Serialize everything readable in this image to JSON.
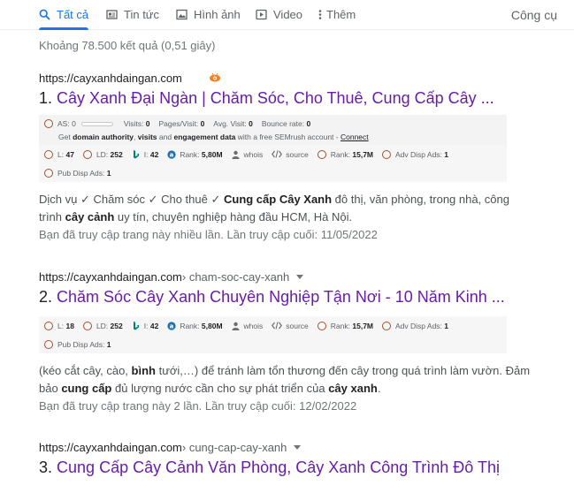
{
  "tabs": [
    {
      "label": "Tất cả"
    },
    {
      "label": "Tin tức"
    },
    {
      "label": "Hình ảnh"
    },
    {
      "label": "Video"
    },
    {
      "label": "Thêm"
    }
  ],
  "tools_label": "Công cụ",
  "stats": "Khoảng 78.500 kết quả (0,51 giây)",
  "colors": {
    "accent": "#1a73e8",
    "visited_link": "#681da8",
    "plugin_ring": "#a0522d"
  },
  "results": [
    {
      "url": "https://cayxanhdaingan.com",
      "path": "",
      "number": "1.",
      "title": "Cây Xanh Đại Ngàn | Chăm Sóc, Cho Thuê, Cung Cấp Cây ...",
      "seo": {
        "as_label": "AS:",
        "as_value": "0",
        "visits_label": "Visits:",
        "visits_value": "0",
        "pages_label": "Pages/Visit:",
        "pages_value": "0",
        "avg_label": "Avg. Visit:",
        "avg_value": "0",
        "bounce_label": "Bounce rate:",
        "bounce_value": "0",
        "promo_prefix": "Get",
        "promo_bold1": "domain authority",
        "promo_sep1": ",",
        "promo_bold2": "visits",
        "promo_mid": "and",
        "promo_bold3": "engagement data",
        "promo_suffix": "with a free SEMrush account -",
        "promo_link": "Connect"
      },
      "metrics": {
        "l_label": "L:",
        "l_value": "47",
        "ld_label": "LD:",
        "ld_value": "252",
        "i_label": "I:",
        "i_value": "42",
        "rank_label": "Rank:",
        "rank_value": "5,80M",
        "whois": "whois",
        "source": "source",
        "rank2_label": "Rank:",
        "rank2_value": "15,7M",
        "adv_label": "Adv Disp Ads:",
        "adv_value": "1",
        "pub_label": "Pub Disp Ads:",
        "pub_value": "1"
      },
      "snippet": [
        {
          "t": "Dịch vụ ✓ Chăm sóc ✓ Cho thuê ✓ ",
          "b": false
        },
        {
          "t": "Cung cấp Cây Xanh",
          "b": true
        },
        {
          "t": " đô thị, văn phòng, trong nhà, công trình ",
          "b": false
        },
        {
          "t": "cây cảnh",
          "b": true
        },
        {
          "t": " uy tín, chuyên nghiệp hàng đầu HCM, Hà Nội.",
          "b": false
        }
      ],
      "visited": "Bạn đã truy cập trang này nhiều lần. Lần truy cập cuối: 11/05/2022"
    },
    {
      "url": "https://cayxanhdaingan.com",
      "path": " › cham-soc-cay-xanh",
      "number": "2.",
      "title": "Chăm Sóc Cây Xanh Chuyên Nghiệp Tận Nơi - 10 Năm Kinh ...",
      "metrics": {
        "l_label": "L:",
        "l_value": "18",
        "ld_label": "LD:",
        "ld_value": "252",
        "i_label": "I:",
        "i_value": "42",
        "rank_label": "Rank:",
        "rank_value": "5,80M",
        "whois": "whois",
        "source": "source",
        "rank2_label": "Rank:",
        "rank2_value": "15,7M",
        "adv_label": "Adv Disp Ads:",
        "adv_value": "1",
        "pub_label": "Pub Disp Ads:",
        "pub_value": "1"
      },
      "snippet": [
        {
          "t": "(kéo cắt cây, cào, ",
          "b": false
        },
        {
          "t": "bình",
          "b": true
        },
        {
          "t": " tưới,…) để tránh làm tổn thương đến cây trong quá trình làm vườn. Đảm bảo ",
          "b": false
        },
        {
          "t": "cung cấp",
          "b": true
        },
        {
          "t": " đủ lượng nước cần cho sự phát triển của ",
          "b": false
        },
        {
          "t": "cây xanh",
          "b": true
        },
        {
          "t": ".",
          "b": false
        }
      ],
      "visited": "Bạn đã truy cập trang này 2 lần. Lần truy cập cuối: 12/02/2022"
    },
    {
      "url": "https://cayxanhdaingan.com",
      "path": " › cung-cap-cay-xanh",
      "number": "3.",
      "title": "Cung Cấp Cây Cảnh Văn Phòng, Cây Xanh Công Trình Đô Thị"
    }
  ]
}
